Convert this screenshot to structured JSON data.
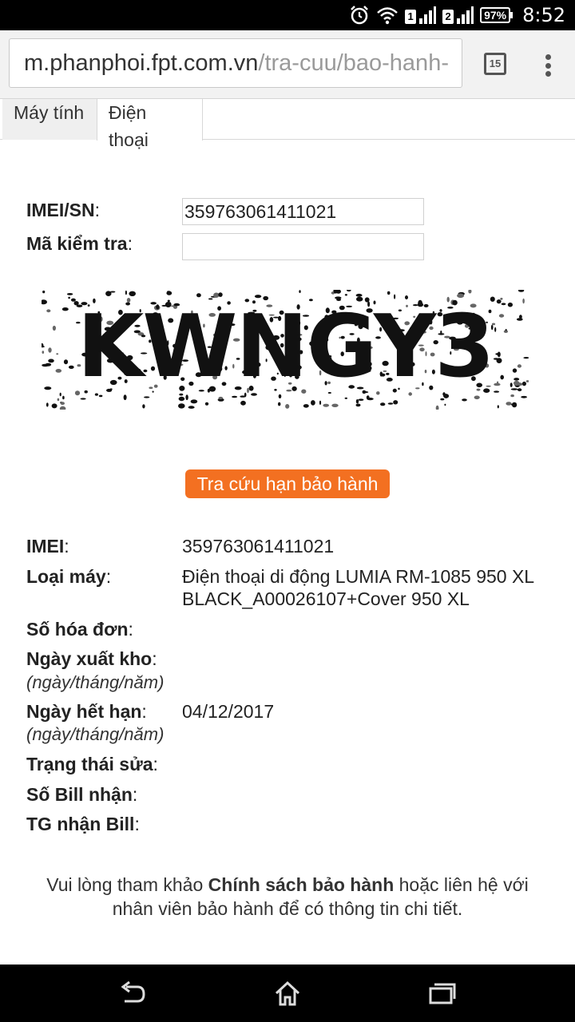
{
  "status_bar": {
    "icons": [
      "alarm-icon",
      "wifi-icon",
      "sim1-signal-icon",
      "sim2-signal-icon",
      "battery-icon"
    ],
    "sim1_label": "1",
    "sim2_label": "2",
    "battery": "97%",
    "time": "8:52"
  },
  "browser": {
    "url_host": "m.phanphoi.fpt.com.vn",
    "url_path": "/tra-cuu/bao-hanh-",
    "tab_count": "15"
  },
  "tabs": [
    {
      "label": "Máy tính",
      "active": false
    },
    {
      "label": "Điện thoại",
      "active": true
    }
  ],
  "form": {
    "imei_label": "IMEI/SN",
    "imei_value": "359763061411021",
    "code_label": "Mã kiểm tra",
    "code_value": "",
    "captcha_text": "KWNGY3",
    "submit_label": "Tra cứu hạn bảo hành"
  },
  "results": {
    "imei_label": "IMEI",
    "imei_value": "359763061411021",
    "model_label": "Loại máy",
    "model_value_line1": "Điện thoại di động LUMIA RM-1085 950 XL",
    "model_value_line2": "BLACK_A00026107+Cover 950 XL",
    "invoice_label": "Số hóa đơn",
    "invoice_value": "",
    "export_date_label": "Ngày xuất kho",
    "export_date_hint": "(ngày/tháng/năm)",
    "export_date_value": "",
    "expiry_label": "Ngày hết hạn",
    "expiry_hint": "(ngày/tháng/năm)",
    "expiry_value": "04/12/2017",
    "repair_status_label": "Trạng thái sửa",
    "repair_status_value": "",
    "bill_no_label": "Số Bill nhận",
    "bill_no_value": "",
    "bill_time_label": "TG nhận Bill",
    "bill_time_value": ""
  },
  "note": {
    "prefix": "Vui lòng tham khảo ",
    "link": "Chính sách bảo hành",
    "suffix": " hoặc liên hệ với nhân viên bảo hành để có thông tin chi tiết."
  },
  "nav": {
    "icons": [
      "back-icon",
      "home-icon",
      "recents-icon"
    ]
  }
}
